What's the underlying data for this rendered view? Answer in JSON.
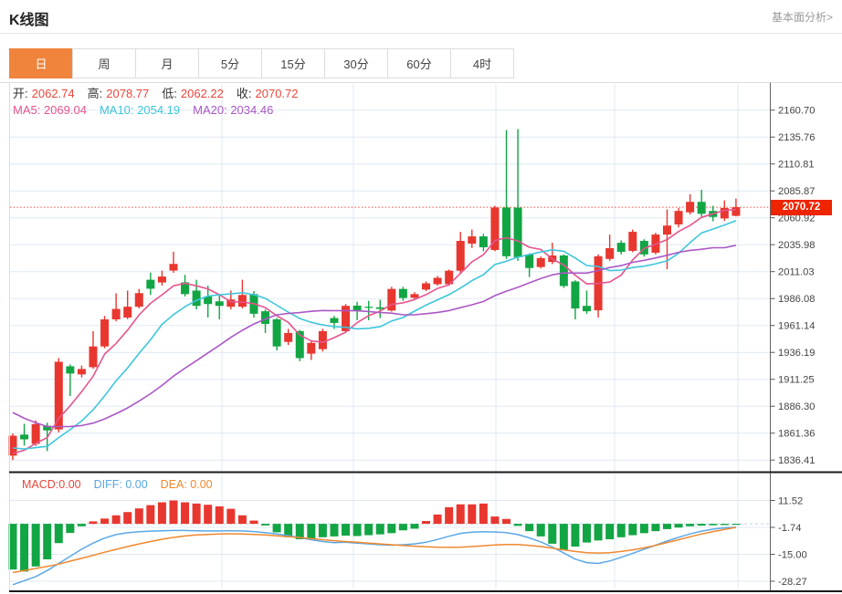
{
  "header": {
    "title": "K线图",
    "link": "基本面分析>"
  },
  "tabs": {
    "items": [
      {
        "key": "day",
        "label": "日",
        "active": true
      },
      {
        "key": "week",
        "label": "周",
        "active": false
      },
      {
        "key": "month",
        "label": "月",
        "active": false
      },
      {
        "key": "5min",
        "label": "5分",
        "active": false
      },
      {
        "key": "15min",
        "label": "15分",
        "active": false
      },
      {
        "key": "30min",
        "label": "30分",
        "active": false
      },
      {
        "key": "60min",
        "label": "60分",
        "active": false
      },
      {
        "key": "4hour",
        "label": "4时",
        "active": false
      }
    ]
  },
  "legend": {
    "ohlc": [
      {
        "label": "开:",
        "value": "2062.74"
      },
      {
        "label": "高:",
        "value": "2078.77"
      },
      {
        "label": "低:",
        "value": "2062.22"
      },
      {
        "label": "收:",
        "value": "2070.72"
      }
    ],
    "ohlc_value_color": "#e8463c",
    "ma": [
      {
        "label": "MA5: 2069.04",
        "color": "#e5548e"
      },
      {
        "label": "MA10: 2054.19",
        "color": "#3ec6dd"
      },
      {
        "label": "MA20: 2034.46",
        "color": "#ab57c5"
      }
    ],
    "macd": [
      {
        "label": "MACD:0.00",
        "color": "#e8463c"
      },
      {
        "label": "DIFF: 0.00",
        "color": "#58a6e8"
      },
      {
        "label": "DEA: 0.00",
        "color": "#f0882e"
      }
    ]
  },
  "price_tag": {
    "value": "2070.72",
    "bg": "#ee2500"
  },
  "colors": {
    "candle_up": "#e8372f",
    "candle_down": "#12a544",
    "ma5": "#e5548e",
    "ma10": "#3ec6dd",
    "ma20": "#ab57c5",
    "diff_line": "#5aa8e8",
    "dea_line": "#f0882e",
    "grid": "#dfe9f3",
    "axis": "#666666",
    "dotted_price_line": "#f5493d",
    "tab_active_bg": "#f0843c"
  },
  "chart_data": {
    "type": "candlestick+macd",
    "title": "K线图",
    "main": {
      "y_axis_labels": [
        "2160.70",
        "2135.76",
        "2110.81",
        "2085.87",
        "2060.92",
        "2035.98",
        "2011.03",
        "1986.08",
        "1961.14",
        "1936.19",
        "1911.25",
        "1886.30",
        "1861.36",
        "1836.41"
      ],
      "y_axis_values": [
        2160.7,
        2135.76,
        2110.81,
        2085.87,
        2060.92,
        2035.98,
        2011.03,
        1986.08,
        1961.14,
        1936.19,
        1911.25,
        1886.3,
        1861.36,
        1836.41
      ],
      "current_price": 2070.72,
      "open": 2062.74,
      "high": 2078.77,
      "low": 2062.22,
      "close": 2070.72,
      "ma5": 2069.04,
      "ma10": 2054.19,
      "ma20": 2034.46,
      "candles_ohlc": [
        [
          1840.5,
          1861,
          1836.4,
          1859
        ],
        [
          1860,
          1870,
          1849.8,
          1855.6
        ],
        [
          1851.4,
          1873.2,
          1849.5,
          1869.8
        ],
        [
          1868.1,
          1871,
          1844.8,
          1863.9
        ],
        [
          1864.8,
          1930.9,
          1862,
          1927.5
        ],
        [
          1923.3,
          1925,
          1895.7,
          1916.6
        ],
        [
          1915.8,
          1924,
          1913,
          1920.8
        ],
        [
          1922.5,
          1955.9,
          1921,
          1941.7
        ],
        [
          1941.7,
          1970,
          1940,
          1966.8
        ],
        [
          1966.8,
          1991,
          1965,
          1976.5
        ],
        [
          1968.5,
          1993.5,
          1967,
          1978.5
        ],
        [
          1978.5,
          1995,
          1977,
          1991.1
        ],
        [
          2003.5,
          2010.2,
          1989.4,
          1995.2
        ],
        [
          2001,
          2012,
          1998,
          2006.5
        ],
        [
          2012,
          2029.5,
          2010,
          2018.2
        ],
        [
          2001.1,
          2008,
          1988,
          1990.2
        ],
        [
          1993.5,
          2003.5,
          1976,
          1979.3
        ],
        [
          1988,
          1998,
          1968.5,
          1981
        ],
        [
          1983.5,
          1989.4,
          1966.8,
          1979.3
        ],
        [
          1978.5,
          1993.5,
          1976,
          1985.2
        ],
        [
          1978.5,
          2003.5,
          1977,
          1989.4
        ],
        [
          1990.2,
          1993,
          1968.5,
          1972
        ],
        [
          1974.3,
          1976,
          1954.2,
          1962.6
        ],
        [
          1966.8,
          1968,
          1938,
          1941.7
        ],
        [
          1945.9,
          1958,
          1943,
          1954.2
        ],
        [
          1955.9,
          1957,
          1928,
          1930.9
        ],
        [
          1935,
          1947,
          1929.2,
          1945
        ],
        [
          1939.2,
          1958,
          1937,
          1955.9
        ],
        [
          1968,
          1970,
          1958,
          1963.5
        ],
        [
          1955.9,
          1981,
          1955,
          1979.3
        ],
        [
          1979.5,
          1983,
          1966,
          1975
        ],
        [
          1978.5,
          1984,
          1966,
          1977.5
        ],
        [
          1978,
          1985,
          1968,
          1976.5
        ],
        [
          1975,
          1997,
          1974,
          1995
        ],
        [
          1995,
          1997,
          1984,
          1986.6
        ],
        [
          1986.8,
          1992,
          1985,
          1990.2
        ],
        [
          1994.4,
          2002,
          1993,
          2000.2
        ],
        [
          1999.4,
          2007,
          1998,
          2005.3
        ],
        [
          1999.4,
          2013,
          1998,
          2011.9
        ],
        [
          2011.9,
          2047.9,
          2010,
          2039.5
        ],
        [
          2037,
          2050,
          2033,
          2043.7
        ],
        [
          2043.7,
          2046,
          2030,
          2033.6
        ],
        [
          2031.1,
          2072,
          2030,
          2070.4
        ],
        [
          2070.4,
          2142.3,
          2022.8,
          2025.3
        ],
        [
          2070.4,
          2143.1,
          2021,
          2024.4
        ],
        [
          2027,
          2028,
          2006,
          2014.4
        ],
        [
          2015.3,
          2025,
          2014,
          2023.6
        ],
        [
          2020,
          2037.8,
          2018,
          2026
        ],
        [
          2026,
          2027,
          1996,
          1997.7
        ],
        [
          2001.9,
          2003,
          1966.8,
          1976.9
        ],
        [
          1979.3,
          1993.5,
          1972,
          1974.3
        ],
        [
          1975.2,
          2027,
          1968.5,
          2025.3
        ],
        [
          2022.8,
          2045.4,
          2021,
          2032.8
        ],
        [
          2037.8,
          2040,
          2027,
          2029.4
        ],
        [
          2030.3,
          2050,
          2029,
          2047.9
        ],
        [
          2039.5,
          2041,
          2025,
          2027
        ],
        [
          2028.6,
          2047,
          2027,
          2045.4
        ],
        [
          2045.4,
          2068.7,
          2013.4,
          2053.7
        ],
        [
          2054.8,
          2070,
          2052,
          2067.3
        ],
        [
          2066,
          2082.7,
          2064,
          2075.7
        ],
        [
          2075.7,
          2086.9,
          2062,
          2064.6
        ],
        [
          2067.3,
          2072,
          2057.7,
          2061.7
        ],
        [
          2060.3,
          2077.1,
          2058,
          2070
        ],
        [
          2062.74,
          2078.77,
          2062.22,
          2070.72
        ]
      ],
      "ma_periods": [
        5,
        10,
        20
      ],
      "ma_prehistory_closes": [
        1975,
        1962,
        1950,
        1938,
        1926,
        1915,
        1905,
        1896,
        1888,
        1880,
        1872,
        1865,
        1858,
        1852,
        1847,
        1843,
        1840,
        1838,
        1837,
        1838
      ]
    },
    "macd": {
      "y_axis_labels": [
        "11.52",
        "-1.74",
        "-15.00",
        "-28.27"
      ],
      "y_axis_values": [
        11.52,
        -1.74,
        -15.0,
        -28.27
      ],
      "hist": [
        -22.5,
        -23.5,
        -21,
        -17.5,
        -9.5,
        -4.5,
        -1.2,
        1.2,
        2.6,
        4.2,
        5.8,
        7.6,
        9.2,
        10.6,
        11.5,
        10.6,
        10,
        9.4,
        8.6,
        7.4,
        4.2,
        1.6,
        -0.8,
        -4.2,
        -6.6,
        -7.6,
        -7.2,
        -6.6,
        -6.2,
        -5.8,
        -6,
        -5.6,
        -5.2,
        -4.6,
        -3.2,
        -2.4,
        1.4,
        4.6,
        8.2,
        9.6,
        9.6,
        10,
        3.6,
        2.4,
        -1,
        -3.6,
        -6.2,
        -9.8,
        -13,
        -11.2,
        -9.2,
        -8.2,
        -7.6,
        -6.6,
        -5.6,
        -4.6,
        -3.6,
        -2.6,
        -1.8,
        -1.2,
        -0.9,
        -0.7,
        -0.6,
        -0.5
      ],
      "diff": [
        -30,
        -28,
        -26,
        -23,
        -19.5,
        -16,
        -12.5,
        -9.5,
        -7,
        -5.3,
        -4.4,
        -3.9,
        -3.6,
        -3.4,
        -3.3,
        -3.3,
        -3.4,
        -3.5,
        -3.5,
        -3.4,
        -3.5,
        -3.8,
        -4.3,
        -5,
        -5.8,
        -6.8,
        -7.8,
        -8.7,
        -9.3,
        -9.1,
        -9.5,
        -9.9,
        -10.3,
        -10.5,
        -10.3,
        -9.9,
        -9.1,
        -7.7,
        -6.1,
        -4.7,
        -4.1,
        -3.9,
        -4,
        -4.3,
        -5.3,
        -6.9,
        -8.9,
        -11.4,
        -14.4,
        -17.4,
        -19.1,
        -19.5,
        -18.3,
        -16.5,
        -14.5,
        -12.5,
        -10.5,
        -8.5,
        -6.6,
        -5,
        -3.6,
        -2.6,
        -2,
        -1.7
      ],
      "dea": [
        -24,
        -23,
        -22,
        -21,
        -19.8,
        -18.4,
        -17,
        -15.5,
        -14,
        -12.6,
        -11.2,
        -9.9,
        -8.7,
        -7.6,
        -6.7,
        -6,
        -5.5,
        -5.2,
        -5,
        -4.9,
        -5,
        -5.2,
        -5.5,
        -5.9,
        -6.3,
        -6.8,
        -7.3,
        -7.8,
        -8.3,
        -8.7,
        -9.1,
        -9.5,
        -9.9,
        -10.3,
        -10.7,
        -11,
        -11.3,
        -11.5,
        -11.6,
        -11.5,
        -11.2,
        -10.8,
        -10.4,
        -10.2,
        -10.2,
        -10.6,
        -11.2,
        -12,
        -12.8,
        -13.6,
        -14.2,
        -14.4,
        -14.2,
        -13.6,
        -12.8,
        -11.8,
        -10.6,
        -9.2,
        -7.8,
        -6.4,
        -5,
        -3.8,
        -2.8,
        -1.74
      ]
    }
  }
}
